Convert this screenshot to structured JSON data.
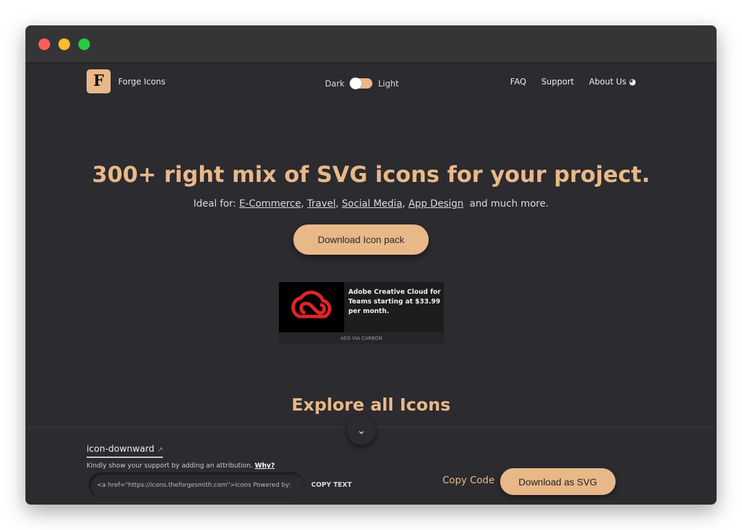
{
  "window": {
    "dots": [
      "#fe5f57",
      "#febc2e",
      "#28c840"
    ]
  },
  "nav": {
    "logo": "F",
    "brand": "Forge Icons",
    "theme_dark": "Dark",
    "theme_light": "Light",
    "links": [
      "FAQ",
      "Support",
      "About Us"
    ]
  },
  "hero": {
    "title": "300+ right mix of SVG icons for your project.",
    "ideal_prefix": "Ideal for:",
    "categories": [
      "E-Commerce",
      "Travel",
      "Social Media",
      "App Design"
    ],
    "ideal_suffix": "and much more.",
    "download_button": "Download Icon pack"
  },
  "ad": {
    "text": "Adobe Creative Cloud for Teams starting at $33.99 per month.",
    "footer": "ADS VIA CARBON"
  },
  "explore": {
    "title": "Explore all Icons"
  },
  "panel": {
    "icon_name": "icon-downward",
    "attribution": "Kindly show your support by adding an attribution.",
    "why": "Why?",
    "code": "<a href=\"https://icons.theforgesmith.com\">Icons Powered by:",
    "copy_text": "COPY TEXT",
    "copy_code": "Copy Code",
    "download_svg": "Download as SVG"
  },
  "colors": {
    "accent": "#e8b888",
    "background": "#2b2b30"
  }
}
